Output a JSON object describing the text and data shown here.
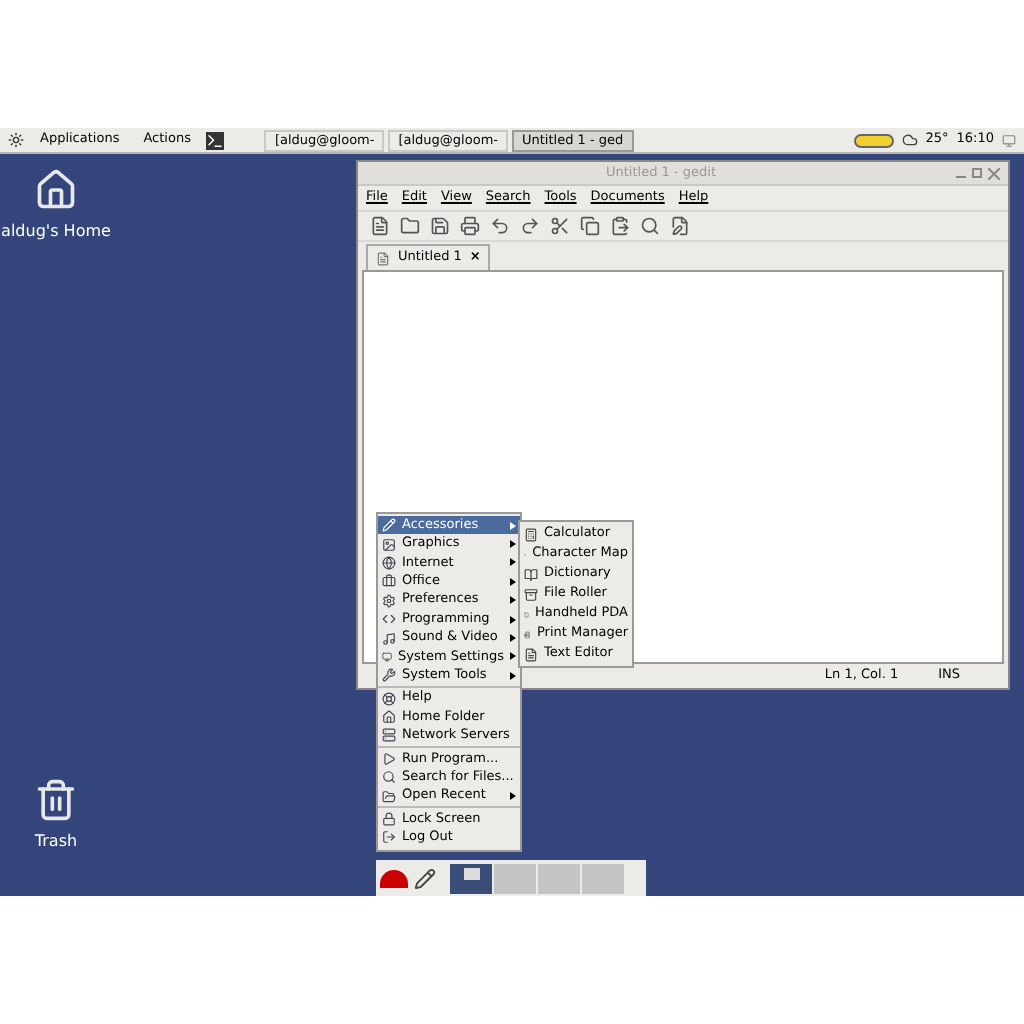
{
  "top_panel": {
    "menus": [
      "Applications",
      "Actions"
    ],
    "tasks": [
      {
        "label": "[aldug@gloom-",
        "selected": false
      },
      {
        "label": "[aldug@gloom-",
        "selected": false
      },
      {
        "label": "Untitled 1 - ged",
        "selected": true
      }
    ],
    "weather": "25°",
    "clock": "16:10"
  },
  "desktop_icons": [
    {
      "label": "aldug's Home",
      "kind": "home"
    },
    {
      "label": "Trash",
      "kind": "trash"
    }
  ],
  "gedit": {
    "title": "Untitled 1 - gedit",
    "menu": [
      "File",
      "Edit",
      "View",
      "Search",
      "Tools",
      "Documents",
      "Help"
    ],
    "tabs": [
      {
        "label": "Untitled 1",
        "selected": true,
        "close": "×"
      }
    ],
    "status": [
      "Ln 1, Col. 1",
      "INS"
    ]
  },
  "app_menu": {
    "items": [
      {
        "kind": "item",
        "label": "Accessories",
        "submenu": true,
        "selected": true
      },
      {
        "kind": "item",
        "label": "Graphics",
        "submenu": true,
        "selected": false
      },
      {
        "kind": "item",
        "label": "Internet",
        "submenu": true,
        "selected": false
      },
      {
        "kind": "item",
        "label": "Office",
        "submenu": true,
        "selected": false
      },
      {
        "kind": "item",
        "label": "Preferences",
        "submenu": true,
        "selected": false
      },
      {
        "kind": "item",
        "label": "Programming",
        "submenu": true,
        "selected": false
      },
      {
        "kind": "item",
        "label": "Sound & Video",
        "submenu": true,
        "selected": false
      },
      {
        "kind": "item",
        "label": "System Settings",
        "submenu": true,
        "selected": false
      },
      {
        "kind": "item",
        "label": "System Tools",
        "submenu": true,
        "selected": false
      },
      {
        "kind": "separator"
      },
      {
        "kind": "item",
        "label": "Help",
        "submenu": false,
        "selected": false
      },
      {
        "kind": "item",
        "label": "Home Folder",
        "submenu": false,
        "selected": false
      },
      {
        "kind": "item",
        "label": "Network Servers",
        "submenu": false,
        "selected": false
      },
      {
        "kind": "separator"
      },
      {
        "kind": "item",
        "label": "Run Program...",
        "submenu": false,
        "selected": false
      },
      {
        "kind": "item",
        "label": "Search for Files...",
        "submenu": false,
        "selected": false
      },
      {
        "kind": "item",
        "label": "Open Recent",
        "submenu": true,
        "selected": false
      },
      {
        "kind": "separator"
      },
      {
        "kind": "item",
        "label": "Lock Screen",
        "submenu": false,
        "selected": false
      },
      {
        "kind": "item",
        "label": "Log Out",
        "submenu": false,
        "selected": false
      }
    ],
    "submenu": [
      "Calculator",
      "Character Map",
      "Dictionary",
      "File Roller",
      "Handheld PDA",
      "Print Manager",
      "Text Editor"
    ]
  },
  "bottom_panel": {
    "workspaces": [
      {
        "selected": true
      },
      {
        "selected": false
      },
      {
        "selected": false
      },
      {
        "selected": false
      }
    ]
  }
}
